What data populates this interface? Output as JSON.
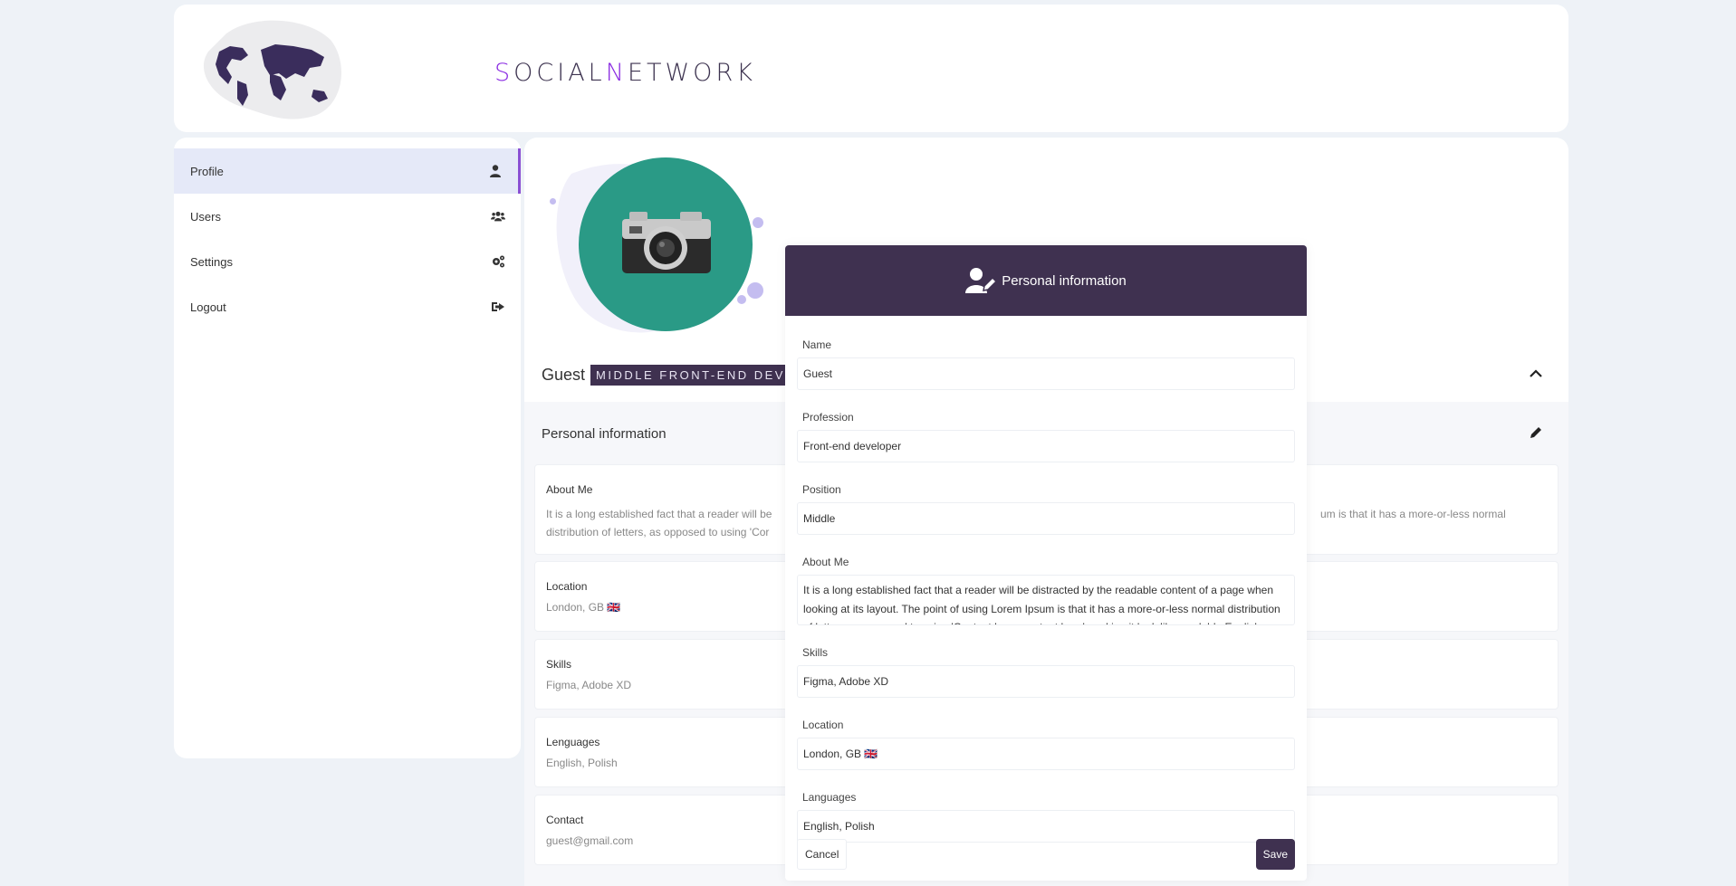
{
  "header": {
    "logo_prefix_1": "S",
    "logo_part_1": "OCIAL",
    "logo_prefix_2": "N",
    "logo_part_2": "ETWORK"
  },
  "sidebar": {
    "items": [
      {
        "label": "Profile",
        "icon": "user-icon",
        "active": true
      },
      {
        "label": "Users",
        "icon": "users-icon",
        "active": false
      },
      {
        "label": "Settings",
        "icon": "gears-icon",
        "active": false
      },
      {
        "label": "Logout",
        "icon": "sign-out-icon",
        "active": false
      }
    ]
  },
  "profile": {
    "name": "Guest",
    "role_badge": "MIDDLE FRONT-END DEVE",
    "section_title": "Personal information",
    "cards": [
      {
        "label": "About Me",
        "value_left": "It is a long established fact that a reader will be",
        "value_right": "um is that it has a more-or-less normal",
        "value_line2": "distribution of letters, as opposed to using 'Cor"
      },
      {
        "label": "Location",
        "value": "London, GB 🇬🇧"
      },
      {
        "label": "Skills",
        "value": "Figma, Adobe XD"
      },
      {
        "label": "Lenguages",
        "value": "English, Polish"
      },
      {
        "label": "Contact",
        "value": "guest@gmail.com"
      }
    ]
  },
  "modal": {
    "title": "Personal information",
    "fields": [
      {
        "label": "Name",
        "value": "Guest"
      },
      {
        "label": "Profession",
        "value": "Front-end developer"
      },
      {
        "label": "Position",
        "value": "Middle"
      },
      {
        "label": "About Me",
        "value": "It is a long established fact that a reader will be distracted by the readable content of a page when looking at its layout. The point of using Lorem Ipsum is that it has a more-or-less normal distribution of letters, as opposed to using 'Content here, content here', making it look like readable English."
      },
      {
        "label": "Skills",
        "value": "Figma, Adobe XD"
      },
      {
        "label": "Location",
        "value": "London, GB 🇬🇧"
      },
      {
        "label": "Languages",
        "value": "English, Polish"
      }
    ],
    "cancel_label": "Cancel",
    "save_label": "Save"
  },
  "colors": {
    "accent_dark": "#3f3150",
    "accent_purple": "#8a2be2",
    "avatar_bg": "#2a9a86",
    "active_bg": "#e5e9f8"
  }
}
